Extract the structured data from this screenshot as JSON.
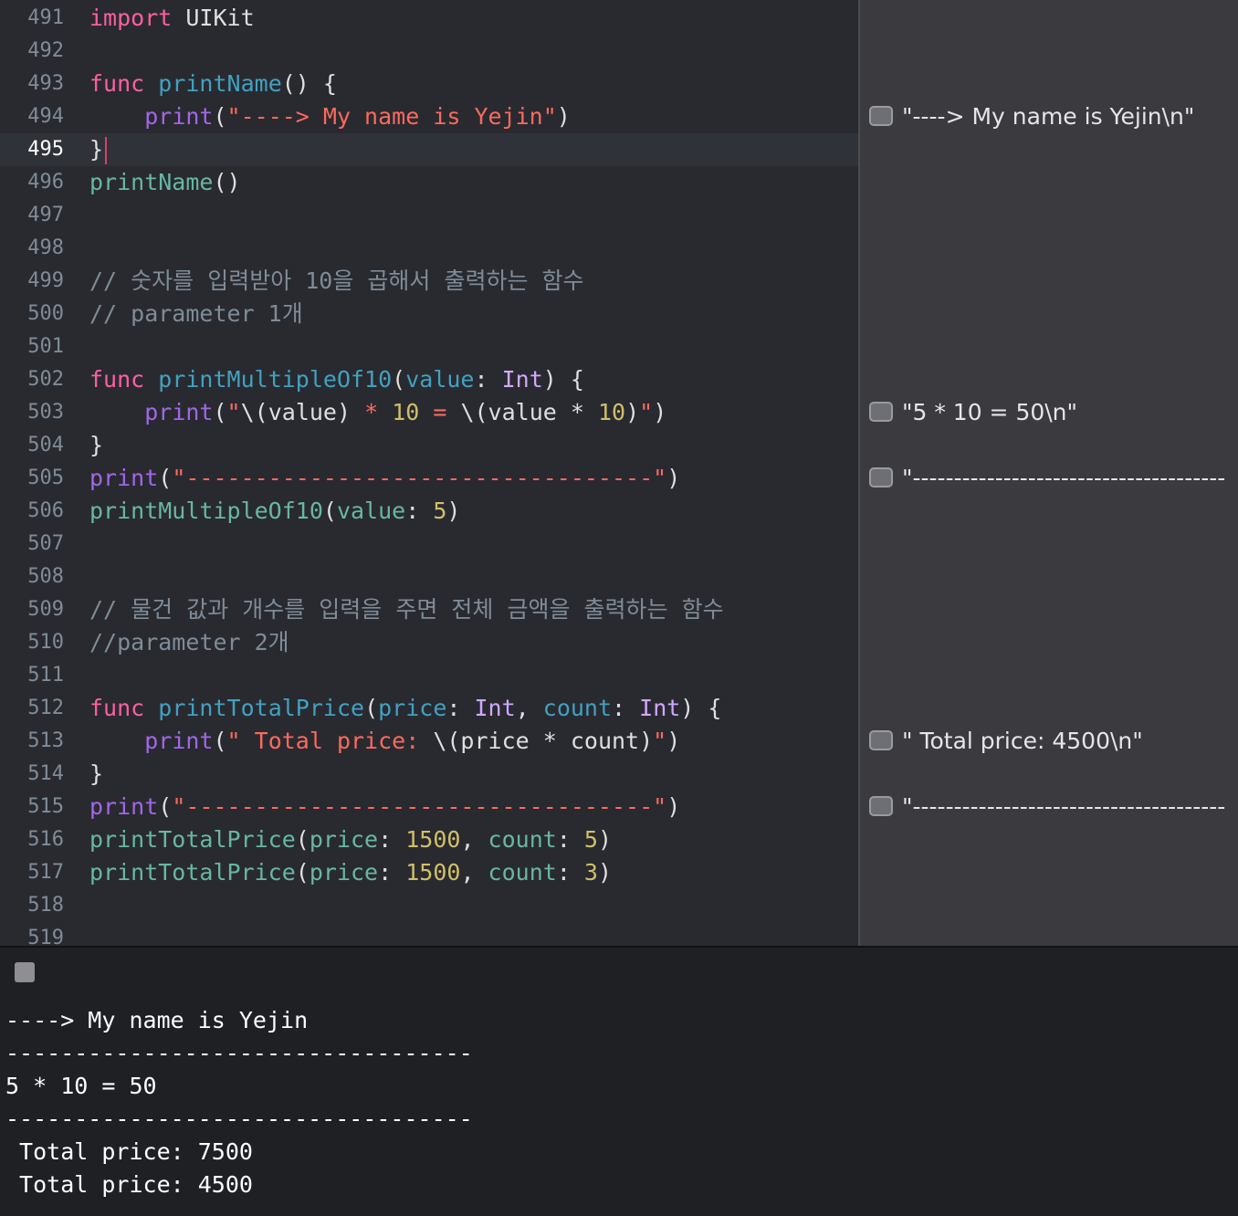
{
  "colors": {
    "keyword": "#fc5fa3",
    "decl_func": "#41a1c0",
    "builtin": "#a167e6",
    "type": "#d0a8ff",
    "project_call": "#67b7a4",
    "string": "#fc6a5d",
    "number": "#d0bf69",
    "comment": "#7f8c98",
    "plain": "#dfdfe0",
    "param": "#67b7a4"
  },
  "editor": {
    "current_line": "495",
    "lines": [
      {
        "n": "491",
        "tokens": [
          [
            "keyword",
            "import"
          ],
          [
            "plain",
            " UIKit"
          ]
        ]
      },
      {
        "n": "492",
        "tokens": []
      },
      {
        "n": "493",
        "tokens": [
          [
            "keyword",
            "func"
          ],
          [
            "plain",
            " "
          ],
          [
            "decl_func",
            "printName"
          ],
          [
            "plain",
            "() {"
          ]
        ]
      },
      {
        "n": "494",
        "tokens": [
          [
            "plain",
            "    "
          ],
          [
            "builtin",
            "print"
          ],
          [
            "plain",
            "("
          ],
          [
            "string",
            "\"----> My name is Yejin\""
          ],
          [
            "plain",
            ")"
          ]
        ]
      },
      {
        "n": "495",
        "tokens": [
          [
            "plain",
            "}"
          ]
        ],
        "caret": true
      },
      {
        "n": "496",
        "tokens": [
          [
            "project_call",
            "printName"
          ],
          [
            "plain",
            "()"
          ]
        ]
      },
      {
        "n": "497",
        "tokens": []
      },
      {
        "n": "498",
        "tokens": []
      },
      {
        "n": "499",
        "tokens": [
          [
            "comment",
            "// 숫자를 입력받아 10을 곱해서 출력하는 함수"
          ]
        ]
      },
      {
        "n": "500",
        "tokens": [
          [
            "comment",
            "// parameter 1개"
          ]
        ]
      },
      {
        "n": "501",
        "tokens": []
      },
      {
        "n": "502",
        "tokens": [
          [
            "keyword",
            "func"
          ],
          [
            "plain",
            " "
          ],
          [
            "decl_func",
            "printMultipleOf10"
          ],
          [
            "plain",
            "("
          ],
          [
            "decl_func",
            "value"
          ],
          [
            "plain",
            ": "
          ],
          [
            "type",
            "Int"
          ],
          [
            "plain",
            ") {"
          ]
        ]
      },
      {
        "n": "503",
        "tokens": [
          [
            "plain",
            "    "
          ],
          [
            "builtin",
            "print"
          ],
          [
            "plain",
            "("
          ],
          [
            "string",
            "\""
          ],
          [
            "plain",
            "\\(value)"
          ],
          [
            "string",
            " * "
          ],
          [
            "number",
            "10"
          ],
          [
            "string",
            " = "
          ],
          [
            "plain",
            "\\(value * "
          ],
          [
            "number",
            "10"
          ],
          [
            "plain",
            ")"
          ],
          [
            "string",
            "\""
          ],
          [
            "plain",
            ")"
          ]
        ]
      },
      {
        "n": "504",
        "tokens": [
          [
            "plain",
            "}"
          ]
        ]
      },
      {
        "n": "505",
        "tokens": [
          [
            "builtin",
            "print"
          ],
          [
            "plain",
            "("
          ],
          [
            "string",
            "\"----------------------------------\""
          ],
          [
            "plain",
            ")"
          ]
        ]
      },
      {
        "n": "506",
        "tokens": [
          [
            "project_call",
            "printMultipleOf10"
          ],
          [
            "plain",
            "("
          ],
          [
            "param",
            "value"
          ],
          [
            "plain",
            ": "
          ],
          [
            "number",
            "5"
          ],
          [
            "plain",
            ")"
          ]
        ]
      },
      {
        "n": "507",
        "tokens": []
      },
      {
        "n": "508",
        "tokens": []
      },
      {
        "n": "509",
        "tokens": [
          [
            "comment",
            "// 물건 값과 개수를 입력을 주면 전체 금액을 출력하는 함수"
          ]
        ]
      },
      {
        "n": "510",
        "tokens": [
          [
            "comment",
            "//parameter 2개"
          ]
        ]
      },
      {
        "n": "511",
        "tokens": []
      },
      {
        "n": "512",
        "tokens": [
          [
            "keyword",
            "func"
          ],
          [
            "plain",
            " "
          ],
          [
            "decl_func",
            "printTotalPrice"
          ],
          [
            "plain",
            "("
          ],
          [
            "decl_func",
            "price"
          ],
          [
            "plain",
            ": "
          ],
          [
            "type",
            "Int"
          ],
          [
            "plain",
            ", "
          ],
          [
            "decl_func",
            "count"
          ],
          [
            "plain",
            ": "
          ],
          [
            "type",
            "Int"
          ],
          [
            "plain",
            ") {"
          ]
        ]
      },
      {
        "n": "513",
        "tokens": [
          [
            "plain",
            "    "
          ],
          [
            "builtin",
            "print"
          ],
          [
            "plain",
            "("
          ],
          [
            "string",
            "\" Total price: "
          ],
          [
            "plain",
            "\\(price * count)"
          ],
          [
            "string",
            "\""
          ],
          [
            "plain",
            ")"
          ]
        ]
      },
      {
        "n": "514",
        "tokens": [
          [
            "plain",
            "}"
          ]
        ]
      },
      {
        "n": "515",
        "tokens": [
          [
            "builtin",
            "print"
          ],
          [
            "plain",
            "("
          ],
          [
            "string",
            "\"----------------------------------\""
          ],
          [
            "plain",
            ")"
          ]
        ]
      },
      {
        "n": "516",
        "tokens": [
          [
            "project_call",
            "printTotalPrice"
          ],
          [
            "plain",
            "("
          ],
          [
            "param",
            "price"
          ],
          [
            "plain",
            ": "
          ],
          [
            "number",
            "1500"
          ],
          [
            "plain",
            ", "
          ],
          [
            "param",
            "count"
          ],
          [
            "plain",
            ": "
          ],
          [
            "number",
            "5"
          ],
          [
            "plain",
            ")"
          ]
        ]
      },
      {
        "n": "517",
        "tokens": [
          [
            "project_call",
            "printTotalPrice"
          ],
          [
            "plain",
            "("
          ],
          [
            "param",
            "price"
          ],
          [
            "plain",
            ": "
          ],
          [
            "number",
            "1500"
          ],
          [
            "plain",
            ", "
          ],
          [
            "param",
            "count"
          ],
          [
            "plain",
            ": "
          ],
          [
            "number",
            "3"
          ],
          [
            "plain",
            ")"
          ]
        ]
      },
      {
        "n": "518",
        "tokens": []
      },
      {
        "n": "519",
        "tokens": []
      }
    ]
  },
  "results_sidebar": {
    "items": [
      {
        "line": "494",
        "text": "\"----> My name is Yejin\\n\"",
        "icon": "quick-look-icon"
      },
      {
        "line": "503",
        "text": "\"5 * 10 = 50\\n\"",
        "icon": "quick-look-icon"
      },
      {
        "line": "505",
        "text": "\"--------------------------------------",
        "icon": "quick-look-icon"
      },
      {
        "line": "513",
        "text": "\" Total price: 4500\\n\"",
        "icon": "quick-look-icon"
      },
      {
        "line": "515",
        "text": "\"--------------------------------------",
        "icon": "quick-look-icon"
      }
    ]
  },
  "console_bar": {
    "stop_icon": "stop-icon"
  },
  "console": {
    "lines": [
      "----> My name is Yejin",
      "----------------------------------",
      "5 * 10 = 50",
      "----------------------------------",
      " Total price: 7500",
      " Total price: 4500"
    ]
  }
}
